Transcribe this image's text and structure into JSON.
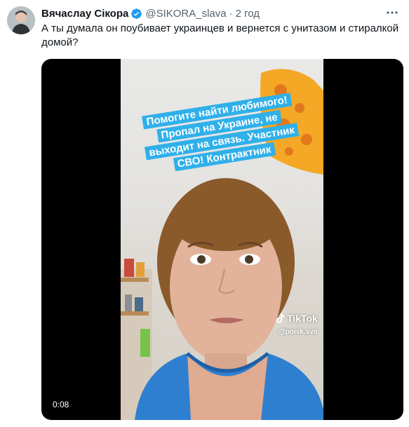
{
  "tweet": {
    "author_name": "Вячаслау Сікора",
    "handle": "@SIKORA_slava",
    "separator": "·",
    "time": "2 год",
    "text": "А ты думала он поубивает украинцев и вернется с унитазом и стиралкой домой?"
  },
  "video": {
    "caption_lines": [
      "Помогите найти любимого!",
      "Пропал на Украине, не",
      "выходит на связь. Участник",
      "СВО! Контрактник"
    ],
    "watermark_brand": "TikTok",
    "watermark_handle": "@poisk.svo",
    "duration": "0:08"
  },
  "colors": {
    "verified": "#1d9bf0",
    "caption_bg": "#2fb0ea",
    "secondary_text": "#536471"
  }
}
